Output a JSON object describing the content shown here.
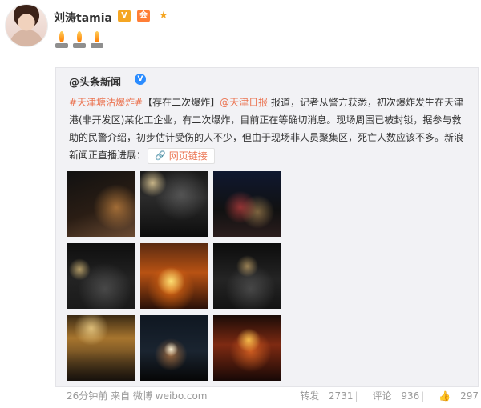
{
  "user": {
    "name": "刘涛tamia",
    "v_badge": "V",
    "vip_badge": "会",
    "medal_icon": "★"
  },
  "repost": {
    "source": "@头条新闻",
    "source_v": "V",
    "text": {
      "hashtag": "#天津塘沽爆炸#",
      "tag": "【存在二次爆炸】",
      "mention": "@天津日报",
      "body": " 报道，记者从警方获悉，初次爆炸发生在天津港(非开发区)某化工企业，有二次爆炸，目前正在等确切消息。现场周围已被封锁，据参与救助的民警介绍，初步估计受伤的人不少，但由于现场非人员聚集区，死亡人数应该不多。新浪新闻正直播进展：",
      "weblink_label": "网页链接"
    }
  },
  "photos": [
    {
      "name": "photo-1"
    },
    {
      "name": "photo-2"
    },
    {
      "name": "photo-3"
    },
    {
      "name": "photo-4"
    },
    {
      "name": "photo-5"
    },
    {
      "name": "photo-6"
    },
    {
      "name": "photo-7"
    },
    {
      "name": "photo-8"
    },
    {
      "name": "photo-9"
    }
  ],
  "footer": {
    "time": "26分钟前",
    "from": "来自",
    "client": "微博 weibo.com",
    "repost_label": "转发",
    "repost_count": "2731",
    "comment_label": "评论",
    "comment_count": "936",
    "like_count": "297"
  },
  "colors": {
    "accent": "#eb7350",
    "repost_bg": "#f2f2f5"
  }
}
